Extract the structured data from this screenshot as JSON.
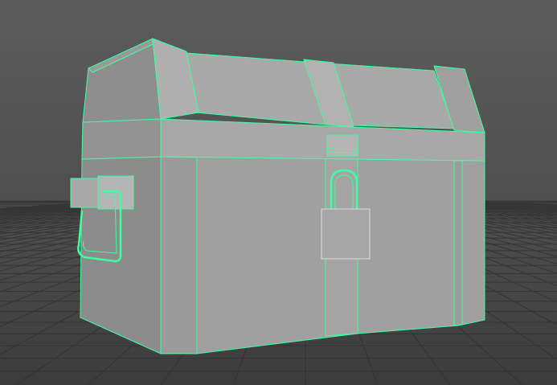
{
  "viewport": {
    "colors": {
      "background_top": "#5a5a5a",
      "background_bottom": "#444444",
      "grid": "#2e2e2e",
      "wireframe": "#3dffa0",
      "face_front": "#a2a2a2",
      "face_side": "#8c8c8c",
      "face_top": "#aaaaaa"
    }
  }
}
